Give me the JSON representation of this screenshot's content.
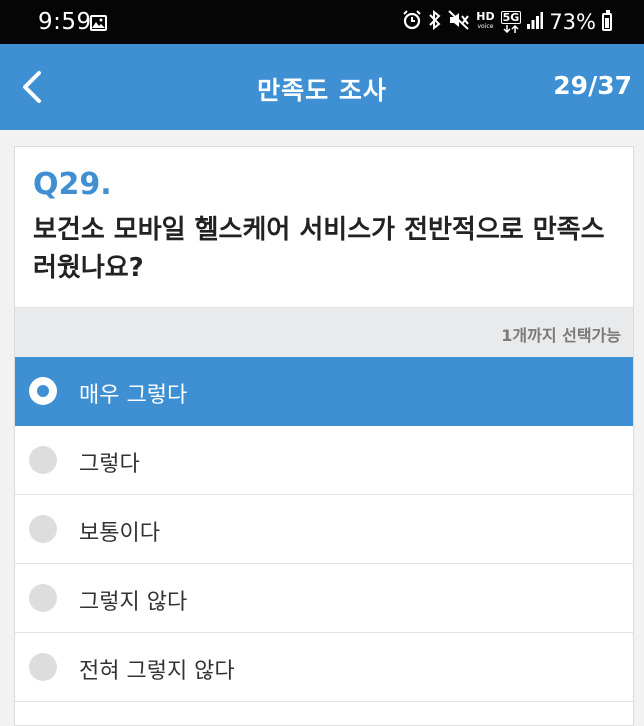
{
  "status_bar": {
    "time": "9:59",
    "battery": "73%",
    "icons": [
      "gallery-icon",
      "alarm-icon",
      "bluetooth-icon",
      "mute-icon",
      "hd-voice-icon",
      "5g-icon",
      "signal-icon",
      "battery-icon"
    ],
    "hd_label": "HD",
    "hd_sub": "voice",
    "network_label": "5G"
  },
  "header": {
    "title": "만족도 조사",
    "progress": "29/37",
    "back_icon": "chevron-left-icon"
  },
  "question": {
    "number": "Q29.",
    "text": "보건소 모바일 헬스케어 서비스가 전반적으로 만족스러웠나요?",
    "hint": "1개까지 선택가능"
  },
  "options": [
    {
      "label": "매우 그렇다",
      "selected": true
    },
    {
      "label": "그렇다",
      "selected": false
    },
    {
      "label": "보통이다",
      "selected": false
    },
    {
      "label": "그렇지 않다",
      "selected": false
    },
    {
      "label": "전혀 그렇지 않다",
      "selected": false
    }
  ],
  "colors": {
    "accent": "#3f8fd3",
    "status_bar_bg": "#050505",
    "hint_bg": "#e9eaeb",
    "radio_unselected": "#dddddd"
  }
}
